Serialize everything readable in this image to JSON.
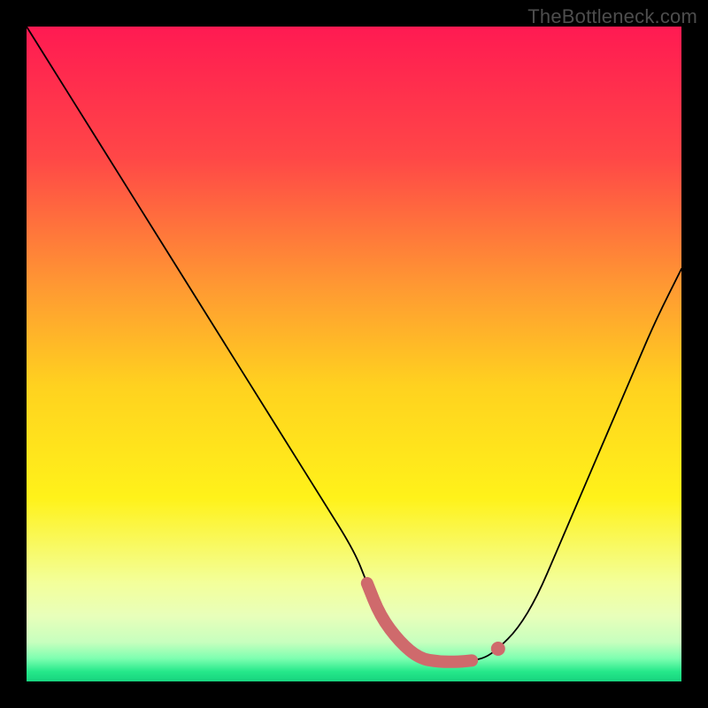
{
  "watermark": "TheBottleneck.com",
  "chart_data": {
    "type": "line",
    "title": "",
    "xlabel": "",
    "ylabel": "",
    "xlim": [
      0,
      100
    ],
    "ylim": [
      0,
      100
    ],
    "grid": false,
    "legend": false,
    "gradient_stops": [
      {
        "pos": 0.0,
        "color": "#ff1a52"
      },
      {
        "pos": 0.2,
        "color": "#ff4747"
      },
      {
        "pos": 0.4,
        "color": "#ff9a32"
      },
      {
        "pos": 0.55,
        "color": "#ffd21f"
      },
      {
        "pos": 0.72,
        "color": "#fff21a"
      },
      {
        "pos": 0.85,
        "color": "#f3ff9b"
      },
      {
        "pos": 0.9,
        "color": "#e8ffba"
      },
      {
        "pos": 0.94,
        "color": "#c7ffbe"
      },
      {
        "pos": 0.965,
        "color": "#7dffb0"
      },
      {
        "pos": 0.985,
        "color": "#25e88a"
      },
      {
        "pos": 1.0,
        "color": "#17d37f"
      }
    ],
    "series": [
      {
        "name": "bottleneck-curve",
        "x": [
          0,
          5,
          10,
          15,
          20,
          25,
          30,
          35,
          40,
          45,
          50,
          52,
          54,
          57,
          60,
          63,
          66,
          68,
          70,
          72,
          75,
          78,
          81,
          84,
          87,
          90,
          93,
          96,
          100
        ],
        "y": [
          100,
          92,
          84,
          76,
          68,
          60,
          52,
          44,
          36,
          28,
          20,
          15,
          10,
          6,
          3.5,
          3,
          3,
          3.2,
          3.6,
          5,
          8,
          13,
          20,
          27,
          34,
          41,
          48,
          55,
          63
        ]
      }
    ],
    "highlight_range_x": [
      52,
      68
    ],
    "highlight_dot_x": 72
  }
}
